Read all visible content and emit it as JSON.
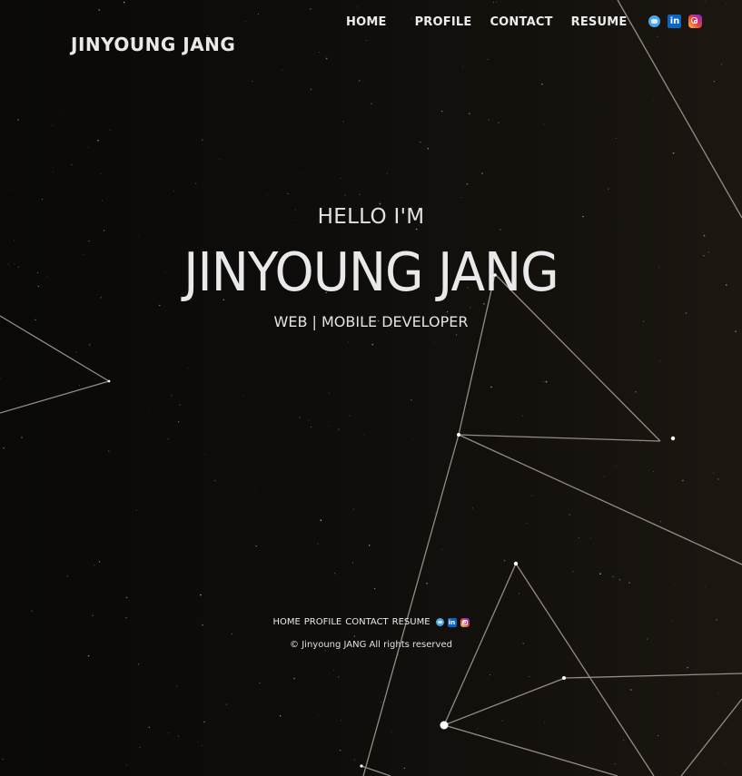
{
  "header": {
    "brand": "JINYOUNG JANG",
    "nav": [
      "HOME",
      "PROFILE",
      "CONTACT",
      "RESUME"
    ],
    "social_icons": [
      "message-icon",
      "linkedin-icon",
      "instagram-icon"
    ]
  },
  "hero": {
    "greeting": "HELLO I'M",
    "name": "JINYOUNG JANG",
    "role": "WEB | MOBILE DEVELOPER"
  },
  "footer": {
    "nav": [
      "HOME",
      "PROFILE",
      "CONTACT",
      "RESUME"
    ],
    "copyright": "© Jinyoung JANG All rights reserved"
  },
  "colors": {
    "background": "#0b0a09",
    "text": "#e9e9e9",
    "lines": "#a8a39c",
    "linkedin": "#0a66c2",
    "message": "#4aa8ea"
  }
}
